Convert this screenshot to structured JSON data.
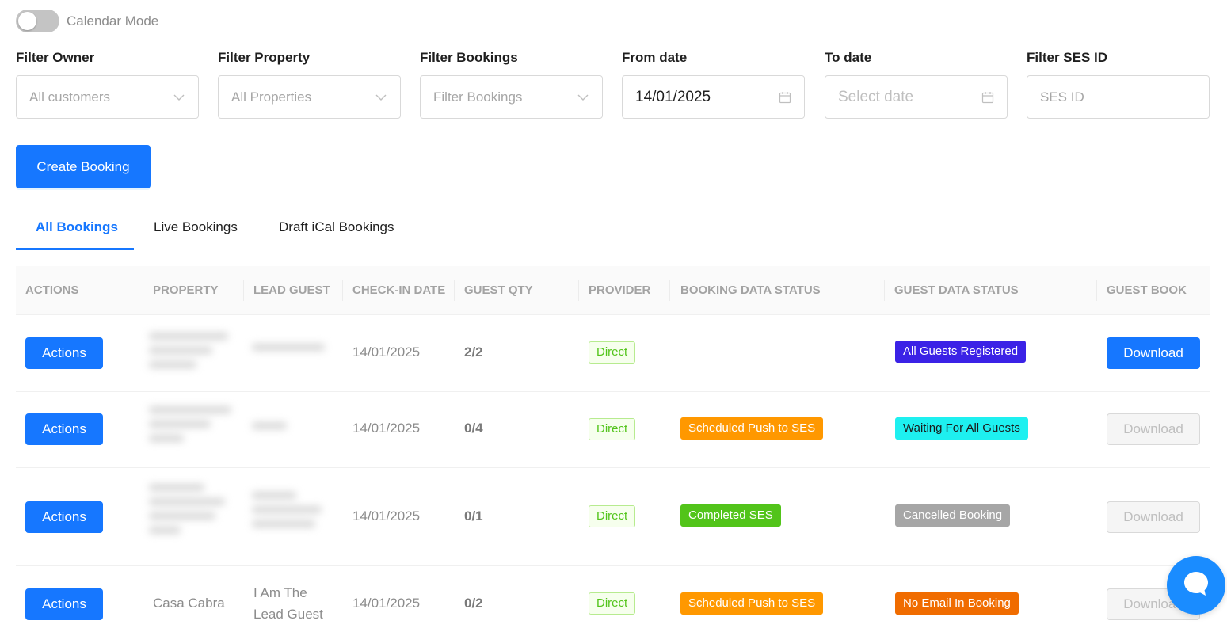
{
  "calendar_mode": {
    "label": "Calendar Mode",
    "enabled": false
  },
  "filters": {
    "owner": {
      "label": "Filter Owner",
      "value": "All customers"
    },
    "property": {
      "label": "Filter Property",
      "value": "All Properties"
    },
    "bookings": {
      "label": "Filter Bookings",
      "value": "Filter Bookings"
    },
    "from_date": {
      "label": "From date",
      "value": "14/01/2025"
    },
    "to_date": {
      "label": "To date",
      "placeholder": "Select date"
    },
    "ses_id": {
      "label": "Filter SES ID",
      "placeholder": "SES ID"
    }
  },
  "create_booking_label": "Create Booking",
  "tabs": [
    {
      "label": "All Bookings",
      "active": true
    },
    {
      "label": "Live Bookings",
      "active": false
    },
    {
      "label": "Draft iCal Bookings",
      "active": false
    }
  ],
  "table": {
    "columns": [
      "Actions",
      "Property",
      "Lead Guest",
      "Check-in Date",
      "Guest Qty",
      "Provider",
      "Booking Data Status",
      "Guest Data Status",
      "Guest Book"
    ],
    "rows": [
      {
        "actions": "Actions",
        "property": "",
        "lead_guest": "",
        "checkin": "14/01/2025",
        "qty": "2/2",
        "provider": "Direct",
        "booking_status": "",
        "guest_status": "All Guests Registered",
        "download": "Download",
        "download_enabled": true
      },
      {
        "actions": "Actions",
        "property": "",
        "lead_guest": "",
        "checkin": "14/01/2025",
        "qty": "0/4",
        "provider": "Direct",
        "booking_status": "Scheduled Push to SES",
        "guest_status": "Waiting For All Guests",
        "download": "Download",
        "download_enabled": false
      },
      {
        "actions": "Actions",
        "property": "",
        "lead_guest": "",
        "checkin": "14/01/2025",
        "qty": "0/1",
        "provider": "Direct",
        "booking_status": "Completed SES",
        "guest_status": "Cancelled Booking",
        "download": "Download",
        "download_enabled": false
      },
      {
        "actions": "Actions",
        "property": "Casa Cabra",
        "lead_guest_line1": "I Am The",
        "lead_guest_line2": "Lead Guest",
        "checkin": "14/01/2025",
        "qty": "0/2",
        "provider": "Direct",
        "booking_status": "Scheduled Push to SES",
        "guest_status": "No Email In Booking",
        "download": "Download",
        "download_enabled": false
      }
    ]
  },
  "colors": {
    "primary": "#1677ff",
    "direct_tag": "#52c41a",
    "scheduled": "#ff9800",
    "completed": "#52c41a",
    "waiting": "#1ef0f0",
    "all_registered": "#3b22e6",
    "cancelled": "#a6a6a6",
    "no_email": "#f06c00"
  },
  "icons": {
    "dropdown": "chevron-down-icon",
    "date": "calendar-icon",
    "chat": "chat-bubble-icon"
  }
}
